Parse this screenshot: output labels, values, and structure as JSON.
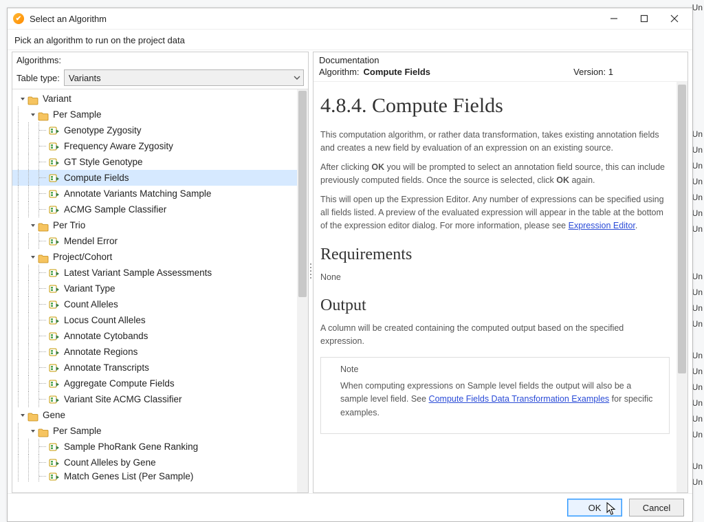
{
  "window": {
    "title": "Select an Algorithm",
    "instruction": "Pick an algorithm to run on the project data"
  },
  "left": {
    "heading": "Algorithms:",
    "table_type_label": "Table type:",
    "table_type_value": "Variants"
  },
  "tree": [
    {
      "depth": 0,
      "type": "folder",
      "expanded": true,
      "label": "Variant"
    },
    {
      "depth": 1,
      "type": "folder",
      "expanded": true,
      "label": "Per Sample"
    },
    {
      "depth": 2,
      "type": "leaf",
      "label": "Genotype Zygosity"
    },
    {
      "depth": 2,
      "type": "leaf",
      "label": "Frequency Aware Zygosity"
    },
    {
      "depth": 2,
      "type": "leaf",
      "label": "GT Style Genotype"
    },
    {
      "depth": 2,
      "type": "leaf",
      "label": "Compute Fields",
      "selected": true
    },
    {
      "depth": 2,
      "type": "leaf",
      "label": "Annotate Variants Matching Sample"
    },
    {
      "depth": 2,
      "type": "leaf",
      "label": "ACMG Sample Classifier"
    },
    {
      "depth": 1,
      "type": "folder",
      "expanded": true,
      "label": "Per Trio"
    },
    {
      "depth": 2,
      "type": "leaf",
      "label": "Mendel Error"
    },
    {
      "depth": 1,
      "type": "folder",
      "expanded": true,
      "label": "Project/Cohort"
    },
    {
      "depth": 2,
      "type": "leaf",
      "label": "Latest Variant Sample Assessments"
    },
    {
      "depth": 2,
      "type": "leaf",
      "label": "Variant Type"
    },
    {
      "depth": 2,
      "type": "leaf",
      "label": "Count Alleles"
    },
    {
      "depth": 2,
      "type": "leaf",
      "label": "Locus Count Alleles"
    },
    {
      "depth": 2,
      "type": "leaf",
      "label": "Annotate Cytobands"
    },
    {
      "depth": 2,
      "type": "leaf",
      "label": "Annotate Regions"
    },
    {
      "depth": 2,
      "type": "leaf",
      "label": "Annotate Transcripts"
    },
    {
      "depth": 2,
      "type": "leaf",
      "label": "Aggregate Compute Fields"
    },
    {
      "depth": 2,
      "type": "leaf",
      "label": "Variant Site ACMG Classifier"
    },
    {
      "depth": 0,
      "type": "folder",
      "expanded": true,
      "label": "Gene"
    },
    {
      "depth": 1,
      "type": "folder",
      "expanded": true,
      "label": "Per Sample"
    },
    {
      "depth": 2,
      "type": "leaf",
      "label": "Sample PhoRank Gene Ranking"
    },
    {
      "depth": 2,
      "type": "leaf",
      "label": "Count Alleles by Gene"
    },
    {
      "depth": 2,
      "type": "leaf",
      "label": "Match Genes List (Per Sample)",
      "cut": true
    }
  ],
  "doc": {
    "heading": "Documentation",
    "algo_label": "Algorithm:",
    "algo_name": "Compute Fields",
    "version_label": "Version:",
    "version": "1",
    "title": "4.8.4. Compute Fields",
    "p1": "This computation algorithm, or rather data transformation, takes existing annotation fields and creates a new field by evaluation of an expression on an existing source.",
    "p2a": "After clicking ",
    "p2_ok1": "OK",
    "p2b": " you will be prompted to select an annotation field source, this can include previously computed fields. Once the source is selected, click ",
    "p2_ok2": "OK",
    "p2c": " again.",
    "p3a": "This will open up the Expression Editor. Any number of expressions can be specified using all fields listed. A preview of the evaluated expression will appear in the table at the bottom of the expression editor dialog. For more information, please see ",
    "p3_link": "Expression Editor",
    "p3b": ".",
    "req_h": "Requirements",
    "req_p": "None",
    "out_h": "Output",
    "out_p": "A column will be created containing the computed output based on the specified expression.",
    "note_title": "Note",
    "note_a": "When computing expressions on Sample level fields the output will also be a sample level field. See ",
    "note_link": "Compute Fields Data Transformation Examples",
    "note_b": " for specific examples."
  },
  "buttons": {
    "ok": "OK",
    "cancel": "Cancel"
  },
  "bg": {
    "right_col": [
      "Un",
      "",
      "",
      "",
      "",
      "",
      "",
      "",
      "Un",
      "Un",
      "Un",
      "Un",
      "Un",
      "Un",
      "Un",
      "",
      "",
      "Un",
      "Un",
      "Un",
      "Un",
      "",
      "Un",
      "Un",
      "Un",
      "Un",
      "Un",
      "Un",
      "",
      "Un",
      "Un",
      ""
    ]
  }
}
